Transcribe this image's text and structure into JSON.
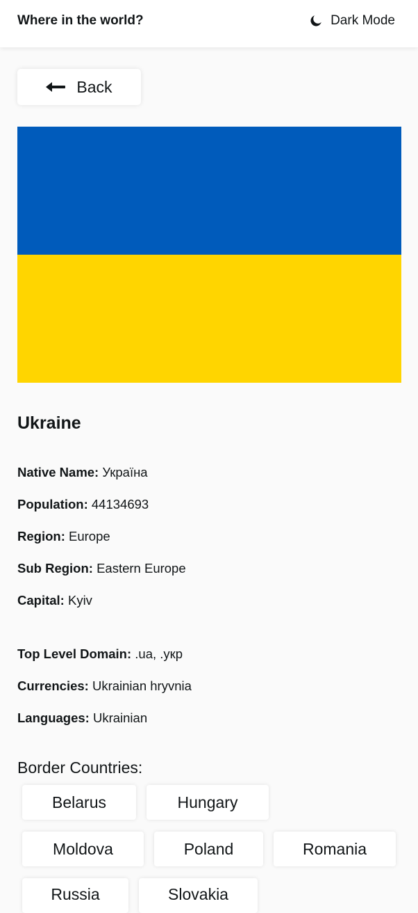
{
  "header": {
    "title": "Where in the world?",
    "theme_toggle_label": "Dark Mode",
    "theme_toggle_icon": "moon-icon"
  },
  "back_button": {
    "label": "Back",
    "icon": "arrow-left-icon"
  },
  "flag": {
    "colors": [
      "#005bbb",
      "#ffd500"
    ]
  },
  "country": {
    "name": "Ukraine",
    "details": [
      {
        "label": "Native Name:",
        "value": "Україна"
      },
      {
        "label": "Population:",
        "value": "44134693"
      },
      {
        "label": "Region:",
        "value": "Europe"
      },
      {
        "label": "Sub Region:",
        "value": "Eastern Europe"
      },
      {
        "label": "Capital:",
        "value": "Kyiv"
      },
      {
        "label": "Top Level Domain:",
        "value": ".ua, .укр"
      },
      {
        "label": "Currencies:",
        "value": "Ukrainian hryvnia"
      },
      {
        "label": "Languages:",
        "value": "Ukrainian"
      }
    ]
  },
  "borders": {
    "title": "Border Countries:",
    "countries": [
      "Belarus",
      "Hungary",
      "Moldova",
      "Poland",
      "Romania",
      "Russia",
      "Slovakia"
    ]
  }
}
